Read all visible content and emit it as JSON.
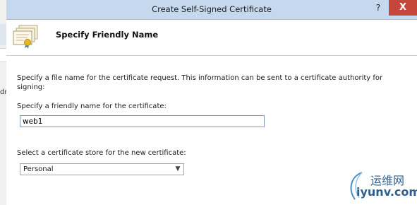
{
  "window": {
    "title": "Create Self-Signed Certificate",
    "help_glyph": "?",
    "close_glyph": "X"
  },
  "header": {
    "title": "Specify Friendly Name",
    "icon": "certificate-icon"
  },
  "content": {
    "description": "Specify a file name for the certificate request.  This information can be sent to a certificate authority for signing:",
    "friendly_name_label": "Specify a friendly name for the certificate:",
    "friendly_name_value": "web1",
    "store_label": "Select a certificate store for the new certificate:",
    "store_selected": "Personal"
  },
  "background_window": {
    "partial_text": "dr"
  },
  "watermark": {
    "text_cn": "运维网",
    "text_url": "iyunv.com"
  },
  "colors": {
    "titlebar": "#c5d8ee",
    "close_button": "#c7463c",
    "input_border": "#7a9bc2",
    "watermark": "#2f5f8a"
  }
}
